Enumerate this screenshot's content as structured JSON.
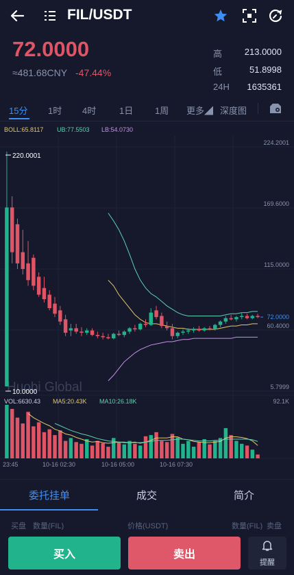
{
  "header": {
    "pair": "FIL/USDT",
    "icons": [
      "back-arrow-icon",
      "menu-list-icon",
      "star-icon",
      "scan-icon",
      "refresh-icon"
    ],
    "accent_color": "#3d8ff5"
  },
  "ticker": {
    "price": "72.0000",
    "cny": "≈481.68CNY",
    "change": "-47.44%",
    "high_label": "高",
    "high": "213.0000",
    "low_label": "低",
    "low": "51.8998",
    "vol_label": "24H",
    "vol": "1635361",
    "down_color": "#e05566",
    "up_color": "#21b38c"
  },
  "intervals": {
    "items": [
      "15分",
      "1时",
      "4时",
      "1日",
      "1周",
      "更多◢",
      "深度图"
    ],
    "active": "15分"
  },
  "indicators": {
    "boll": "BOLL:65.8117",
    "ub": "UB:77.5503",
    "lb": "LB:54.0730",
    "vol": "VOL:6630.43",
    "ma5": "MA5:20.43K",
    "ma10": "MA10:26.18K"
  },
  "chart_data": {
    "type": "candlestick",
    "price_axis_ticks": [
      "224.2001",
      "169.6000",
      "115.0000",
      "60.4000",
      "5.7999"
    ],
    "price_ylim": [
      5.7999,
      224.2001
    ],
    "current_price_label": "72.0000",
    "max_marker": "220.0001",
    "min_marker": "10.0000",
    "volume_axis_max": "92.1K",
    "time_labels": [
      "23:45",
      "10-16 02:30",
      "10-16 05:00",
      "10-16 07:30"
    ],
    "watermark": "Huobi Global",
    "candles": [
      {
        "o": 10,
        "h": 220,
        "l": 10,
        "c": 170
      },
      {
        "o": 170,
        "h": 180,
        "l": 120,
        "c": 130
      },
      {
        "o": 155,
        "h": 160,
        "l": 115,
        "c": 120
      },
      {
        "o": 130,
        "h": 150,
        "l": 110,
        "c": 115
      },
      {
        "o": 120,
        "h": 140,
        "l": 100,
        "c": 105
      },
      {
        "o": 125,
        "h": 128,
        "l": 96,
        "c": 100
      },
      {
        "o": 108,
        "h": 112,
        "l": 90,
        "c": 92
      },
      {
        "o": 98,
        "h": 108,
        "l": 85,
        "c": 88
      },
      {
        "o": 92,
        "h": 96,
        "l": 78,
        "c": 80
      },
      {
        "o": 84,
        "h": 90,
        "l": 72,
        "c": 75
      },
      {
        "o": 78,
        "h": 82,
        "l": 65,
        "c": 68
      },
      {
        "o": 70,
        "h": 74,
        "l": 55,
        "c": 58
      },
      {
        "o": 60,
        "h": 66,
        "l": 55,
        "c": 62
      },
      {
        "o": 62,
        "h": 66,
        "l": 57,
        "c": 59
      },
      {
        "o": 59,
        "h": 63,
        "l": 55,
        "c": 58
      },
      {
        "o": 58,
        "h": 62,
        "l": 56,
        "c": 60
      },
      {
        "o": 60,
        "h": 62,
        "l": 55,
        "c": 56
      },
      {
        "o": 56,
        "h": 59,
        "l": 53,
        "c": 55
      },
      {
        "o": 55,
        "h": 58,
        "l": 52,
        "c": 54
      },
      {
        "o": 54,
        "h": 57,
        "l": 52,
        "c": 53
      },
      {
        "o": 53,
        "h": 58,
        "l": 52,
        "c": 57
      },
      {
        "o": 57,
        "h": 60,
        "l": 55,
        "c": 56
      },
      {
        "o": 56,
        "h": 60,
        "l": 54,
        "c": 59
      },
      {
        "o": 59,
        "h": 63,
        "l": 57,
        "c": 62
      },
      {
        "o": 62,
        "h": 65,
        "l": 59,
        "c": 61
      },
      {
        "o": 61,
        "h": 67,
        "l": 60,
        "c": 66
      },
      {
        "o": 66,
        "h": 70,
        "l": 63,
        "c": 65
      },
      {
        "o": 65,
        "h": 80,
        "l": 64,
        "c": 76
      },
      {
        "o": 78,
        "h": 82,
        "l": 70,
        "c": 72
      },
      {
        "o": 73,
        "h": 76,
        "l": 62,
        "c": 64
      },
      {
        "o": 64,
        "h": 68,
        "l": 60,
        "c": 62
      },
      {
        "o": 62,
        "h": 66,
        "l": 52,
        "c": 55
      },
      {
        "o": 55,
        "h": 59,
        "l": 53,
        "c": 58
      },
      {
        "o": 58,
        "h": 61,
        "l": 56,
        "c": 59
      },
      {
        "o": 59,
        "h": 62,
        "l": 57,
        "c": 60
      },
      {
        "o": 60,
        "h": 63,
        "l": 58,
        "c": 61
      },
      {
        "o": 61,
        "h": 64,
        "l": 59,
        "c": 60
      },
      {
        "o": 60,
        "h": 63,
        "l": 59,
        "c": 62
      },
      {
        "o": 62,
        "h": 64,
        "l": 60,
        "c": 61
      },
      {
        "o": 61,
        "h": 66,
        "l": 60,
        "c": 65
      },
      {
        "o": 65,
        "h": 69,
        "l": 63,
        "c": 68
      },
      {
        "o": 68,
        "h": 73,
        "l": 66,
        "c": 71
      },
      {
        "o": 71,
        "h": 74,
        "l": 69,
        "c": 70
      },
      {
        "o": 70,
        "h": 73,
        "l": 68,
        "c": 72
      },
      {
        "o": 72,
        "h": 76,
        "l": 70,
        "c": 73
      },
      {
        "o": 73,
        "h": 75,
        "l": 70,
        "c": 71
      },
      {
        "o": 71,
        "h": 74,
        "l": 70,
        "c": 73
      },
      {
        "o": 73,
        "h": 75,
        "l": 71,
        "c": 72
      }
    ],
    "boll_mid": [
      null,
      null,
      null,
      null,
      null,
      null,
      null,
      null,
      null,
      null,
      null,
      null,
      null,
      null,
      null,
      null,
      null,
      null,
      null,
      105,
      100,
      92,
      86,
      80,
      74,
      70,
      67,
      66,
      66,
      65,
      64,
      63,
      62,
      62,
      61,
      61,
      61,
      61,
      61,
      61,
      62,
      63,
      64,
      64,
      65,
      65,
      66,
      66
    ],
    "boll_upper": [
      null,
      null,
      null,
      null,
      null,
      null,
      null,
      null,
      null,
      null,
      null,
      null,
      null,
      null,
      null,
      null,
      null,
      null,
      null,
      165,
      158,
      150,
      140,
      128,
      115,
      105,
      98,
      93,
      90,
      86,
      82,
      79,
      76,
      74,
      73,
      73,
      73,
      73,
      73,
      73,
      73,
      74,
      75,
      75,
      76,
      76,
      77,
      77
    ],
    "boll_lower": [
      null,
      null,
      null,
      null,
      null,
      null,
      null,
      null,
      null,
      null,
      null,
      null,
      null,
      null,
      null,
      null,
      null,
      null,
      null,
      15,
      20,
      26,
      32,
      36,
      40,
      43,
      45,
      47,
      48,
      49,
      50,
      50,
      51,
      52,
      52,
      53,
      53,
      53,
      53,
      53,
      53,
      53,
      53,
      54,
      54,
      54,
      54,
      54
    ],
    "volumes": [
      92,
      85,
      70,
      60,
      80,
      55,
      62,
      45,
      50,
      40,
      48,
      30,
      35,
      28,
      25,
      33,
      22,
      30,
      26,
      20,
      35,
      28,
      24,
      30,
      25,
      22,
      38,
      40,
      45,
      30,
      28,
      42,
      36,
      25,
      30,
      20,
      28,
      33,
      24,
      30,
      35,
      52,
      40,
      30,
      25,
      22,
      15,
      6.6
    ],
    "volume_ma5": [
      null,
      null,
      null,
      null,
      77,
      70,
      65,
      60,
      56,
      50,
      47,
      42,
      40,
      36,
      33,
      30,
      28,
      29,
      27,
      26,
      27,
      28,
      27,
      27,
      28,
      26,
      28,
      31,
      35,
      35,
      35,
      37,
      37,
      33,
      32,
      29,
      28,
      27,
      27,
      28,
      29,
      35,
      37,
      37,
      36,
      34,
      30,
      22
    ],
    "volume_ma10": [
      null,
      null,
      null,
      null,
      null,
      null,
      null,
      null,
      null,
      60,
      56,
      52,
      48,
      45,
      42,
      40,
      37,
      34,
      32,
      30,
      29,
      28,
      28,
      27,
      27,
      27,
      28,
      29,
      31,
      31,
      31,
      32,
      33,
      33,
      32,
      31,
      30,
      30,
      30,
      31,
      31,
      33,
      33,
      33,
      33,
      33,
      32,
      29
    ]
  },
  "bottom_tabs": {
    "items": [
      "委托挂单",
      "成交",
      "简介"
    ],
    "active": "委托挂单"
  },
  "orderbook_header": {
    "buy": "买盘",
    "qty_left": "数量(FIL)",
    "price": "价格(USDT)",
    "qty_right": "数量(FIL)",
    "sell": "卖盘"
  },
  "actions": {
    "buy_label": "买入",
    "sell_label": "卖出",
    "alert_label": "提醒"
  }
}
